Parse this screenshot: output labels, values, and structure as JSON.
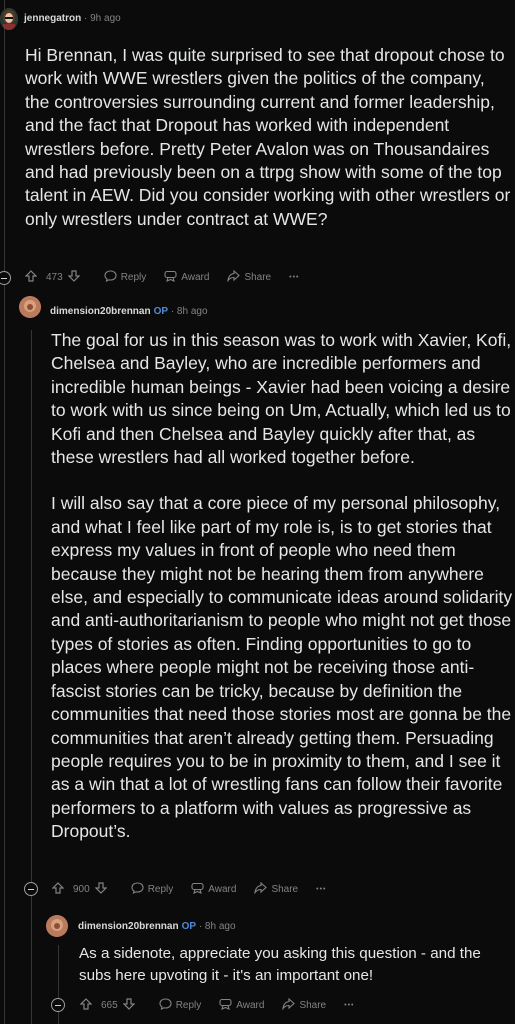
{
  "comment1": {
    "username": "jennegatron",
    "time": "9h ago",
    "text": "Hi Brennan, I was quite surprised to see that dropout chose to work with WWE wrestlers given the politics of the company, the controversies surrounding current and former leadership, and the fact that Dropout has worked with independent wrestlers before. Pretty Peter Avalon was on Thousandaires and had previously been on a ttrpg show with some of the top talent in AEW. Did you consider working with other wrestlers or only wrestlers under contract at WWE?",
    "votes": "473",
    "reply": "Reply",
    "award": "Award",
    "share": "Share",
    "more": "•••"
  },
  "comment2": {
    "username": "dimension20brennan",
    "op": "OP",
    "time": "8h ago",
    "paragraphs": [
      "The goal for us in this season was to work with Xavier, Kofi, Chelsea and Bayley, who are incredible performers and incredible human beings - Xavier had been voicing a desire to work with us since being on Um, Actually, which led us to Kofi and then Chelsea and Bayley quickly after that, as these wrestlers had all worked together before.",
      "I will also say that a core piece of my personal philosophy, and what I feel like part of my role is, is to get stories that express my values in front of people who need them because they might not be hearing them from anywhere else, and especially to communicate ideas around solidarity and anti-authoritarianism to people who might not get those types of stories as often. Finding opportunities to go to places where people might not be receiving those anti-fascist stories can be tricky, because by definition the communities that need those stories most are gonna be the communities that aren’t already getting them. Persuading people requires you to be in proximity to them, and I see it as a win that a lot of wrestling fans can follow their favorite performers to a platform with values as progressive as Dropout’s."
    ],
    "votes": "900",
    "reply": "Reply",
    "award": "Award",
    "share": "Share",
    "more": "•••"
  },
  "comment3": {
    "username": "dimension20brennan",
    "op": "OP",
    "time": "8h ago",
    "text": "As a sidenote, appreciate you asking this question - and the subs here upvoting it - it's an important one!",
    "votes": "665",
    "reply": "Reply",
    "award": "Award",
    "share": "Share",
    "more": "•••"
  }
}
